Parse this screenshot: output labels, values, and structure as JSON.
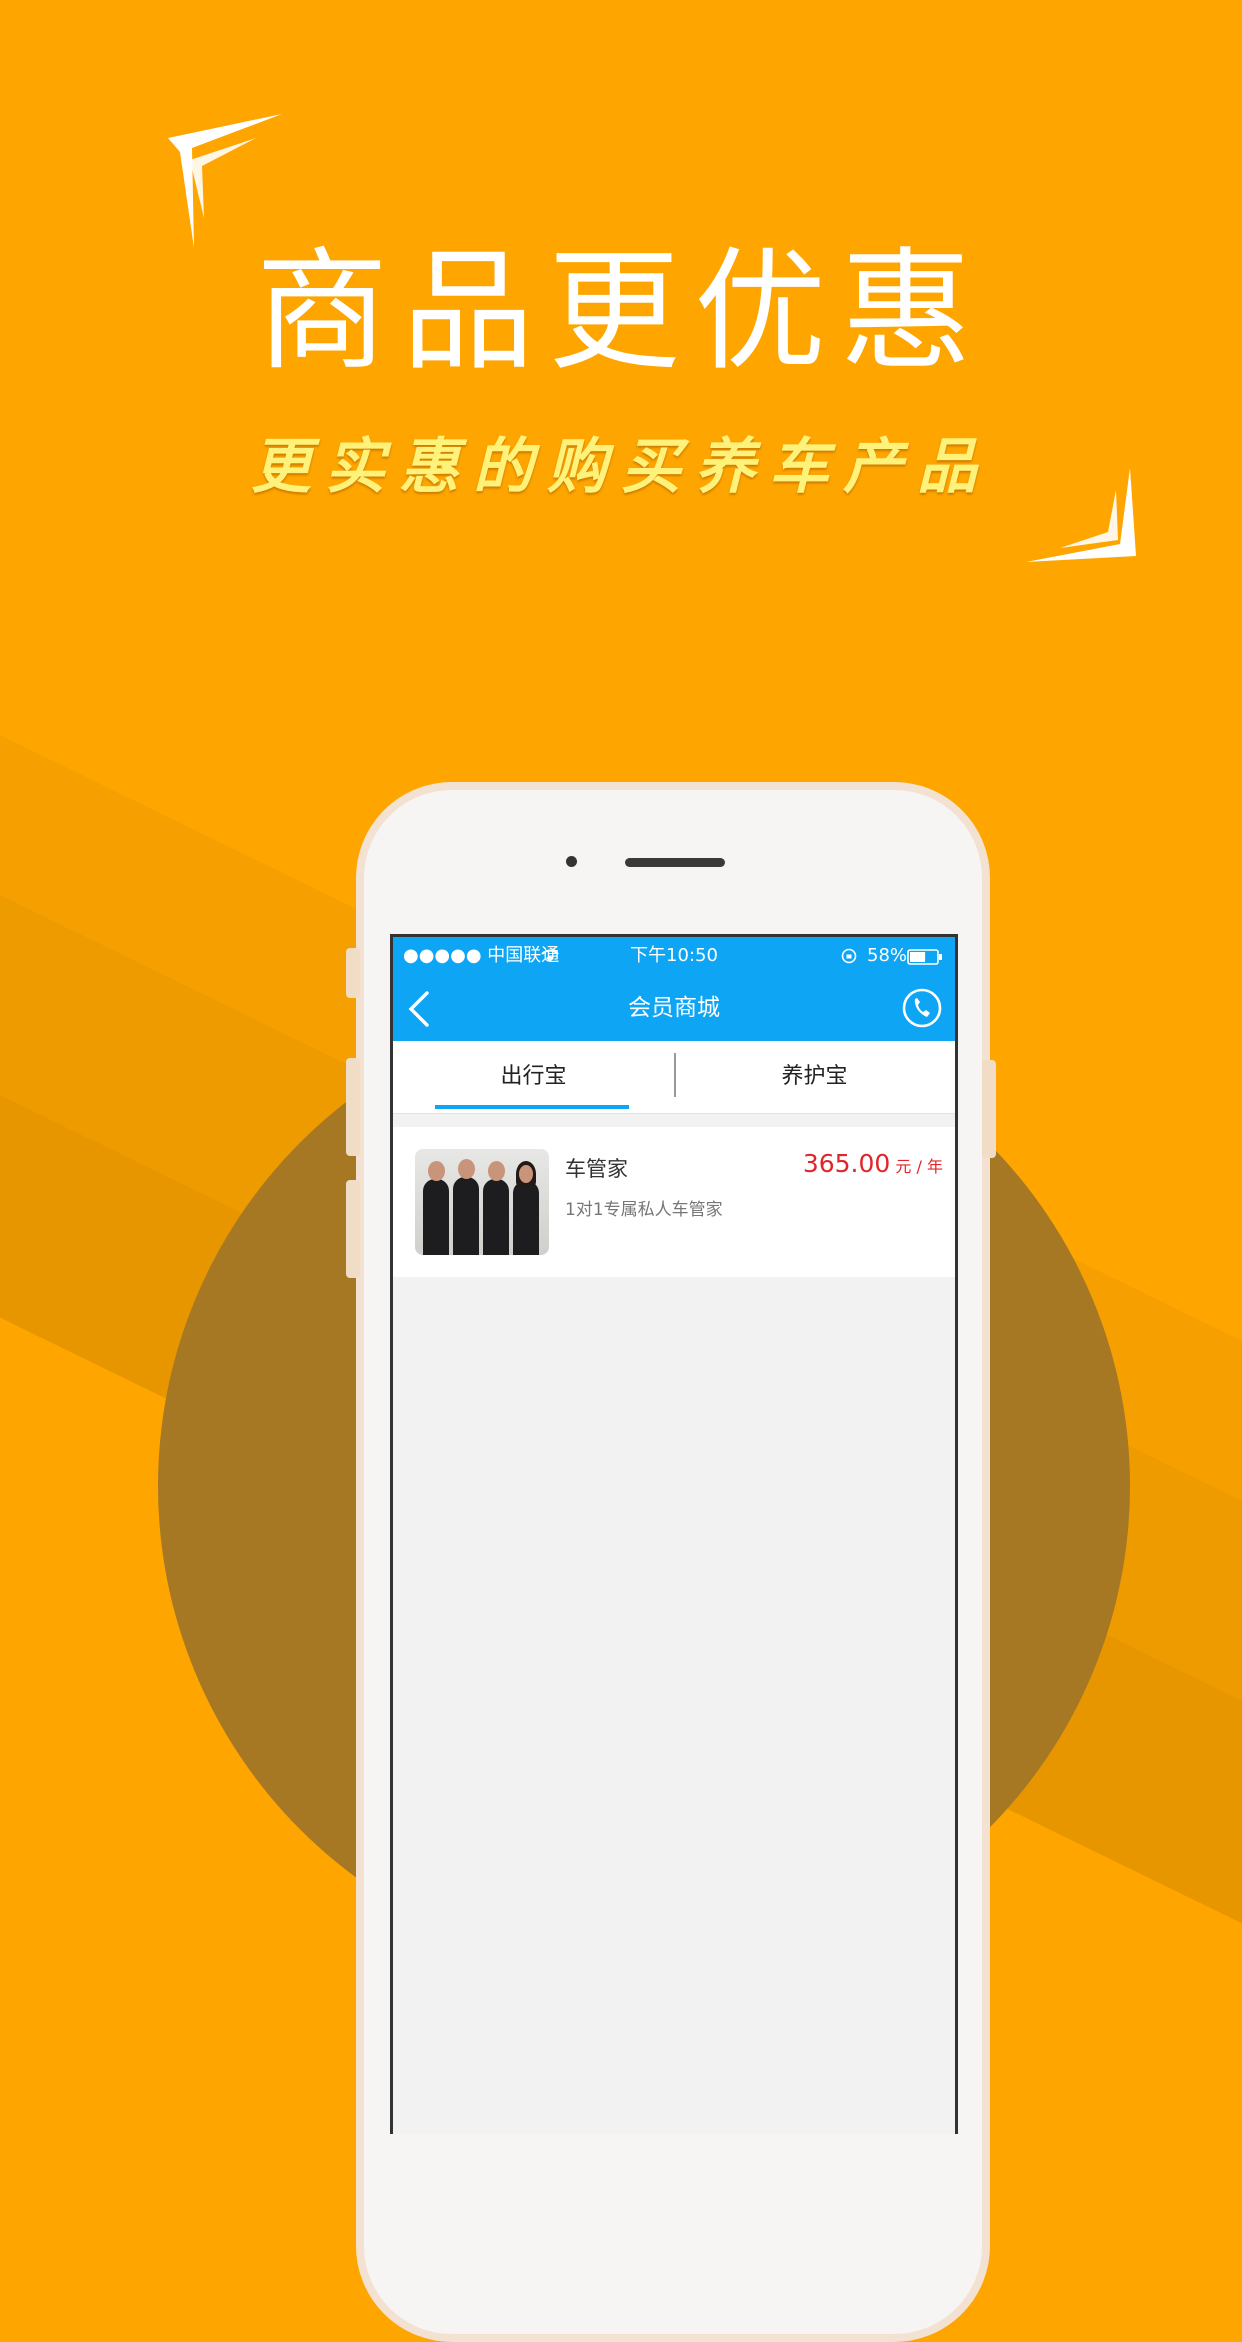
{
  "promo": {
    "headline": "商品更优惠",
    "subline": "更实惠的购买养车产品"
  },
  "status_bar": {
    "carrier": "●●●●● 中国联通",
    "time": "下午10:50",
    "battery": "58%",
    "battery_level": 0.58
  },
  "nav": {
    "title": "会员商城",
    "back_icon": "chevron-left-icon",
    "phone_icon": "phone-icon"
  },
  "tabs": [
    {
      "label": "出行宝",
      "active": true
    },
    {
      "label": "养护宝",
      "active": false
    }
  ],
  "products": [
    {
      "name": "车管家",
      "description": "1对1专属私人车管家",
      "price": "365.00",
      "unit": "元 / 年"
    }
  ],
  "colors": {
    "background": "#FFA500",
    "circle": "#A67824",
    "nav_blue": "#0EA6F4",
    "price_red": "#E0262A",
    "subline_yellow": "#FFF27A"
  }
}
